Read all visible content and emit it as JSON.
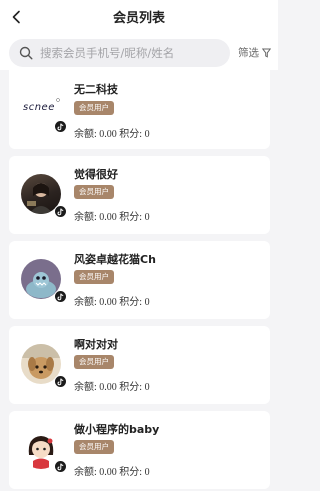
{
  "header": {
    "title": "会员列表"
  },
  "search": {
    "placeholder": "搜索会员手机号/昵称/姓名",
    "filter_label": "筛选"
  },
  "members": [
    {
      "name": "无二科技",
      "badge": "会员用户",
      "balance_label": "余额:",
      "balance": "0.00",
      "points_label": "积分:",
      "points": "0",
      "avatar_logo": "scnee"
    },
    {
      "name": "觉得很好",
      "badge": "会员用户",
      "balance_label": "余额:",
      "balance": "0.00",
      "points_label": "积分:",
      "points": "0"
    },
    {
      "name": "风姿卓越花猫Ch",
      "badge": "会员用户",
      "balance_label": "余额:",
      "balance": "0.00",
      "points_label": "积分:",
      "points": "0"
    },
    {
      "name": "啊对对对",
      "badge": "会员用户",
      "balance_label": "余额:",
      "balance": "0.00",
      "points_label": "积分:",
      "points": "0"
    },
    {
      "name": "做小程序的baby",
      "badge": "会员用户",
      "balance_label": "余额:",
      "balance": "0.00",
      "points_label": "积分:",
      "points": "0"
    }
  ]
}
